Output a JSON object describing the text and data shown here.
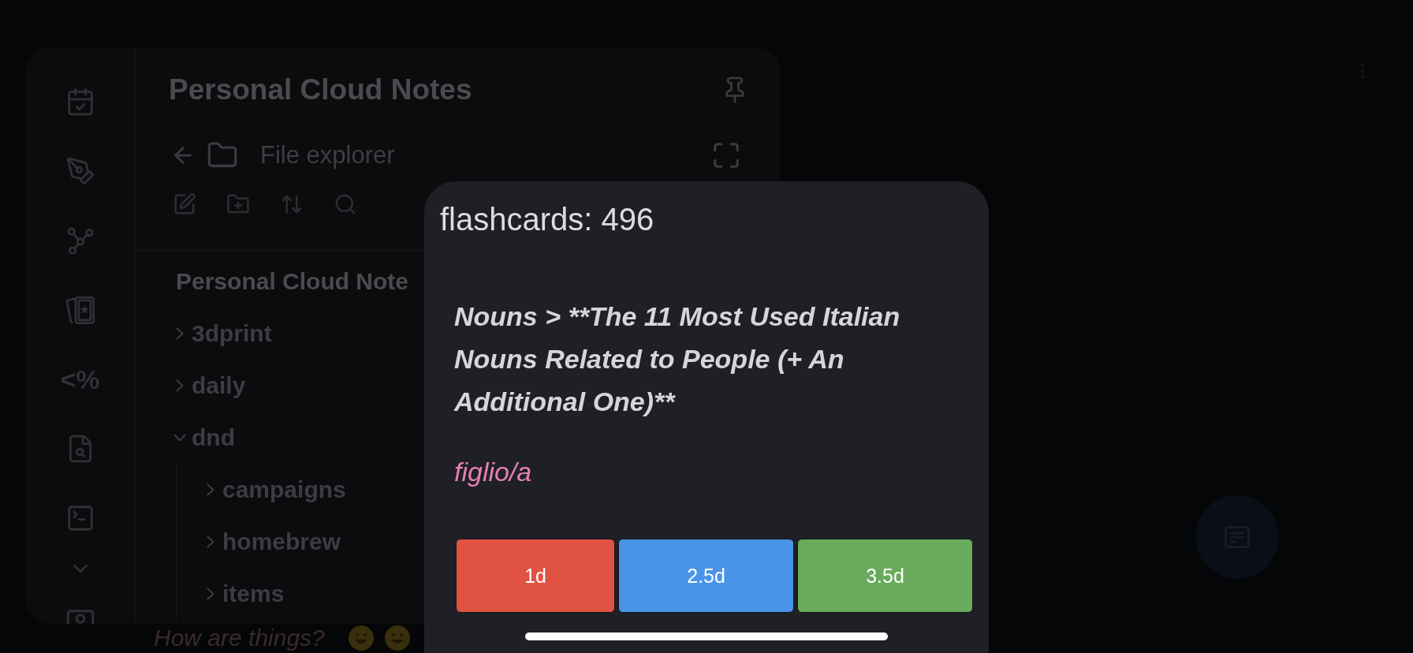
{
  "file_panel": {
    "title": "Personal Cloud Notes",
    "ribbon": {
      "template_glyph": "<%"
    },
    "view": {
      "title": "File explorer"
    },
    "tree": {
      "root": "Personal Cloud Note",
      "items": [
        {
          "name": "3dprint",
          "expanded": false
        },
        {
          "name": "daily",
          "expanded": false
        },
        {
          "name": "dnd",
          "expanded": true,
          "children": [
            {
              "name": "campaigns",
              "expanded": false
            },
            {
              "name": "homebrew",
              "expanded": false
            },
            {
              "name": "items",
              "expanded": false
            }
          ]
        }
      ]
    }
  },
  "note": {
    "line": "How are things?"
  },
  "flashcard_modal": {
    "title": "flashcards: 496",
    "question": "Nouns > **The 11 Most Used Italian Nouns Related to People (+ An Additional One)**",
    "answer": "figlio/a",
    "buttons": [
      {
        "label": "1d",
        "color": "#e05343"
      },
      {
        "label": "2.5d",
        "color": "#4a94e8"
      },
      {
        "label": "3.5d",
        "color": "#68ab5c"
      }
    ]
  }
}
